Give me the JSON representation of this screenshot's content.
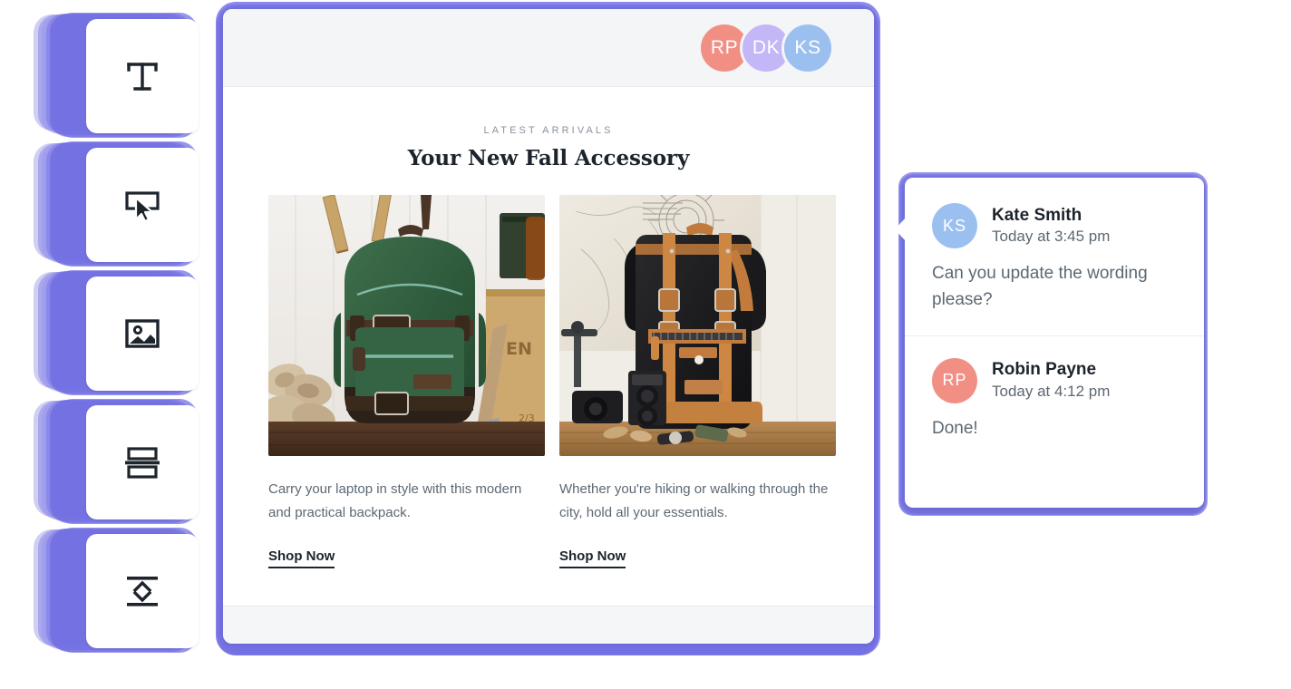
{
  "app": {
    "accent": "#6f6ce0",
    "accent_light": "#a5a3f0",
    "canvas_bg": "#ffffff"
  },
  "toolbar": {
    "name": "block-toolbar",
    "items": [
      {
        "id": "text",
        "icon": "text-block-icon",
        "label": "Text"
      },
      {
        "id": "button",
        "icon": "button-block-icon",
        "label": "Button"
      },
      {
        "id": "image",
        "icon": "image-block-icon",
        "label": "Image"
      },
      {
        "id": "divider",
        "icon": "divider-block-icon",
        "label": "Divider"
      },
      {
        "id": "spacer",
        "icon": "spacer-block-icon",
        "label": "Spacer"
      }
    ]
  },
  "editor": {
    "header": {
      "bg": "#f4f5f7",
      "collaborators": [
        {
          "initials": "RP",
          "name": "Robin Payne",
          "color": "#f28f85"
        },
        {
          "initials": "DK",
          "name": "DK",
          "color": "#c3b7f7"
        },
        {
          "initials": "KS",
          "name": "Kate Smith",
          "color": "#9bc0f0"
        }
      ]
    },
    "email": {
      "eyebrow": "LATEST ARRIVALS",
      "headline": "Your New Fall Accessory",
      "cards": [
        {
          "image_alt": "green-canvas-backpack-photo",
          "text": "Carry your laptop in style with this modern and practical backpack.",
          "cta": "Shop Now"
        },
        {
          "image_alt": "black-leather-rolltop-backpack-photo",
          "text": "Whether you're hiking or walking through the city, hold all your essentials.",
          "cta": "Shop Now"
        }
      ]
    }
  },
  "comment_panel": {
    "comments": [
      {
        "initials": "KS",
        "avatar_color": "#9bc0f0",
        "author": "Kate Smith",
        "timestamp": "Today at 3:45 pm",
        "body": "Can you update the wording please?"
      },
      {
        "initials": "RP",
        "avatar_color": "#f28f85",
        "author": "Robin Payne",
        "timestamp": "Today at 4:12 pm",
        "body": "Done!"
      }
    ]
  }
}
